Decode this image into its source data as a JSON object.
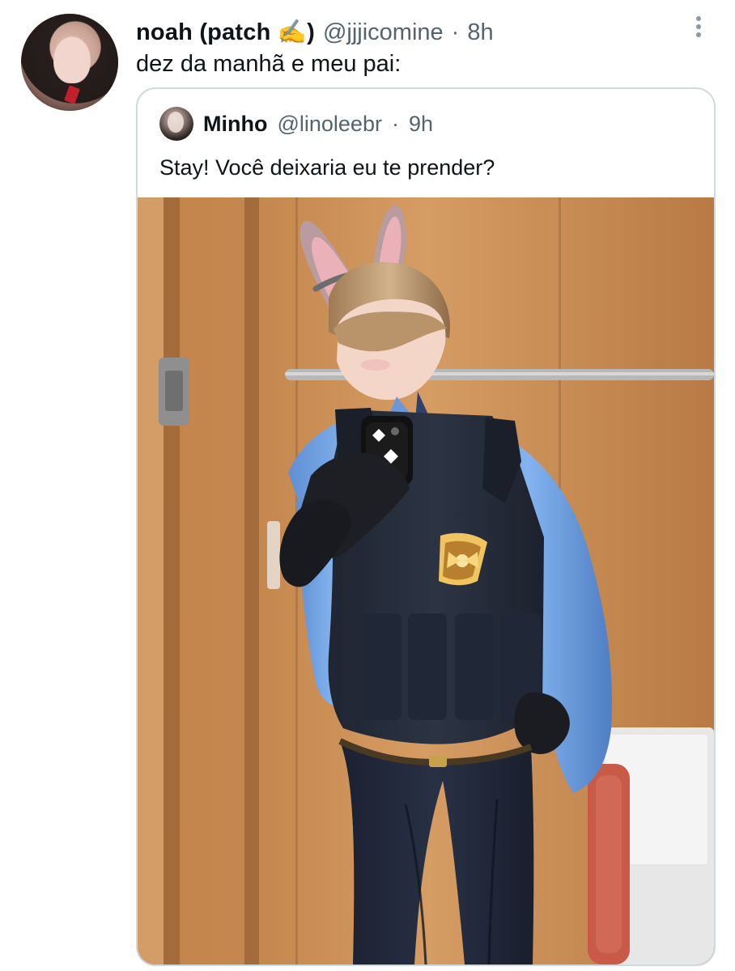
{
  "tweet": {
    "display_name": "noah (patch ✍️)",
    "username": "@jjjicomine",
    "separator": "·",
    "time": "8h",
    "text": "dez da manhã e meu pai:"
  },
  "quoted_tweet": {
    "display_name": "Minho",
    "username": "@linoleebr",
    "separator": "·",
    "time": "9h",
    "text": "Stay! Você deixaria eu te prender?"
  },
  "icons": {
    "more": "more-vertical-icon"
  },
  "colors": {
    "border": "#cfd9de",
    "secondary_text": "#536471",
    "primary_text": "#0f1419"
  }
}
